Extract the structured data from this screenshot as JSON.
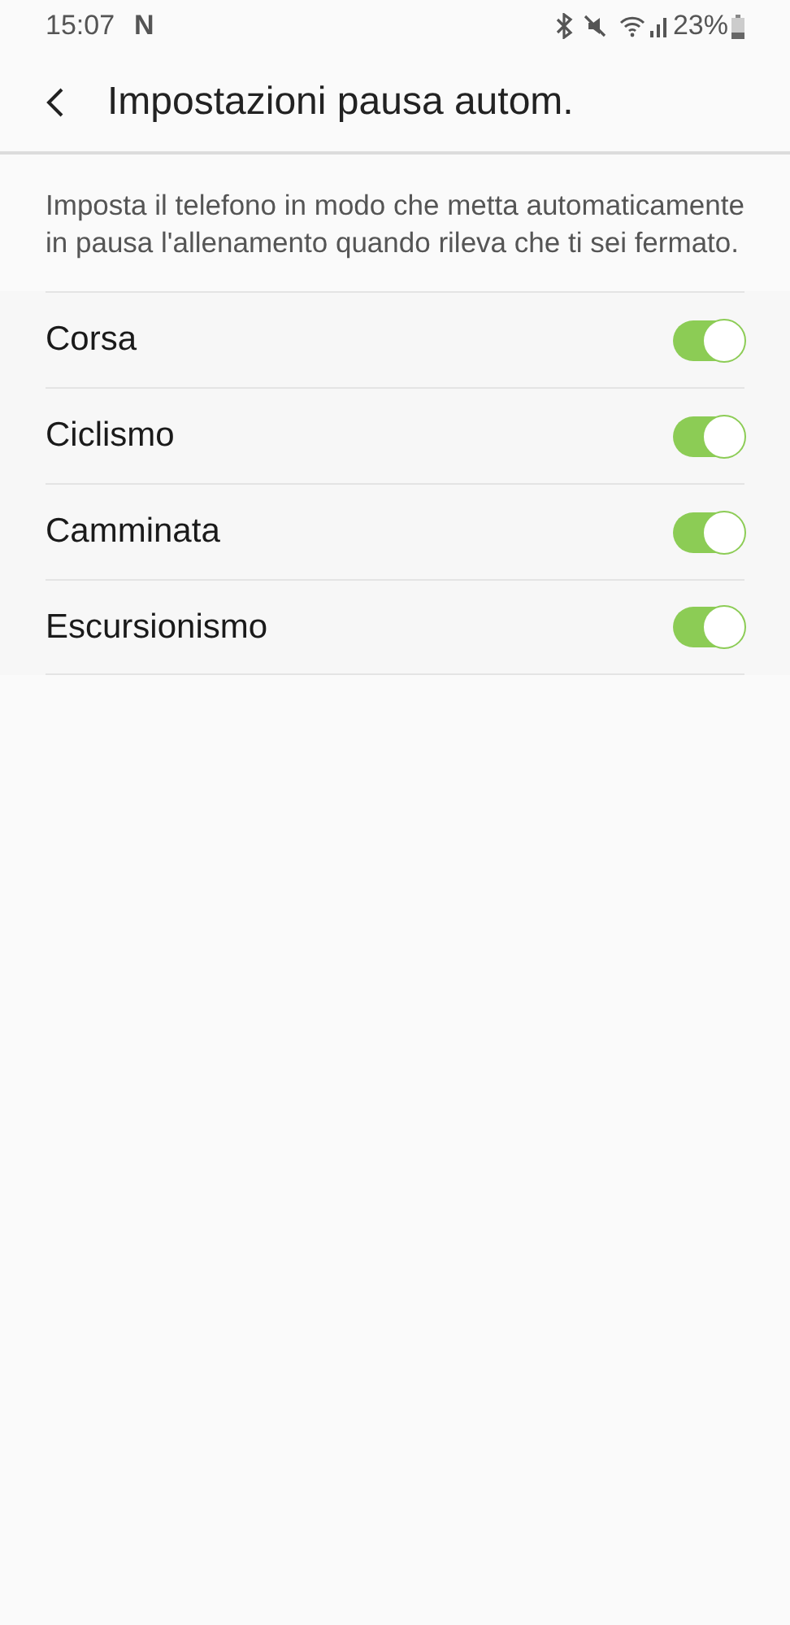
{
  "status_bar": {
    "time": "15:07",
    "notification": "N",
    "battery": "23%"
  },
  "header": {
    "title": "Impostazioni pausa autom."
  },
  "description": "Imposta il telefono in modo che metta automaticamente in pausa l'allenamento quando rileva che ti sei fermato.",
  "activities": [
    {
      "label": "Corsa",
      "on": true
    },
    {
      "label": "Ciclismo",
      "on": true
    },
    {
      "label": "Camminata",
      "on": true
    },
    {
      "label": "Escursionismo",
      "on": true
    }
  ]
}
